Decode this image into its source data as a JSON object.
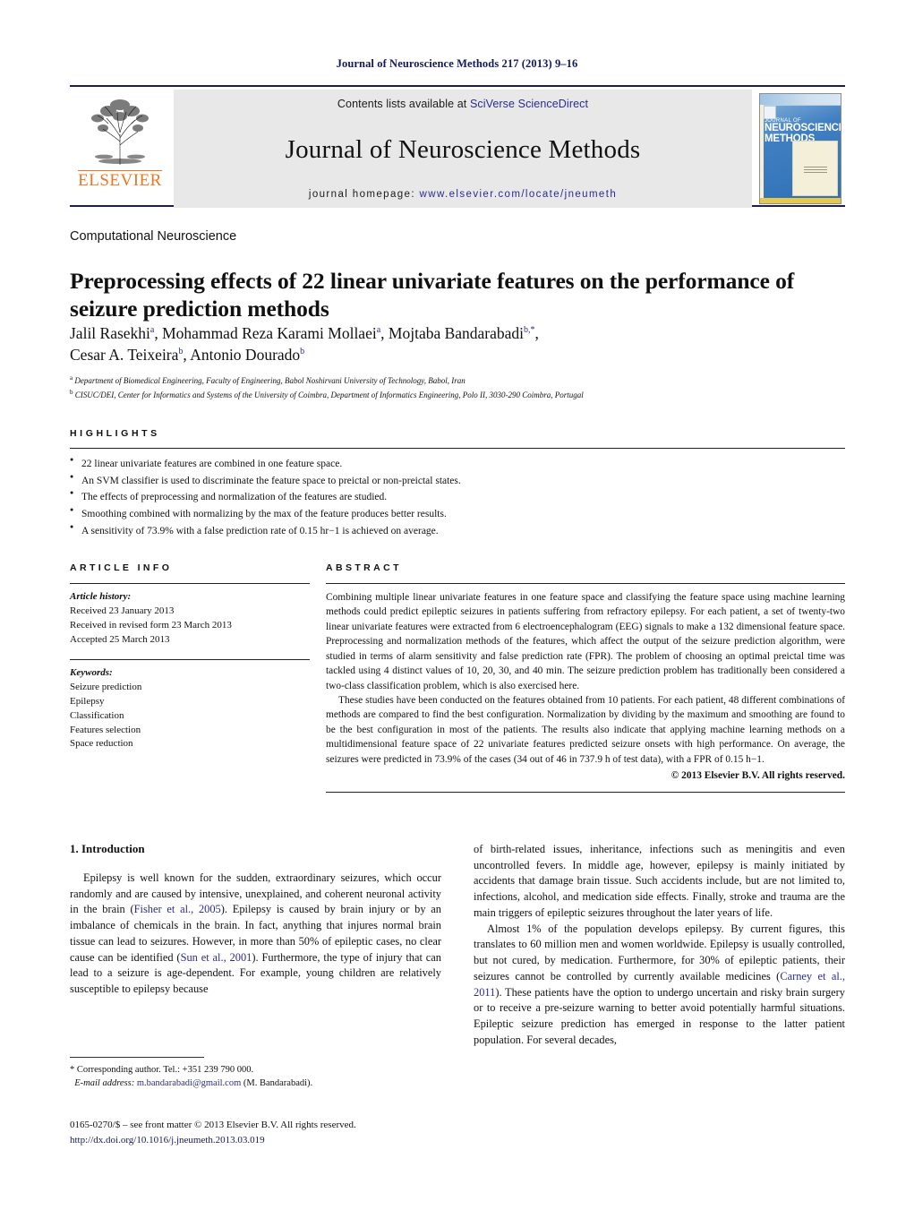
{
  "running_head": "Journal of Neuroscience Methods 217 (2013) 9–16",
  "masthead": {
    "contents_prefix": "Contents lists available at ",
    "contents_link": "SciVerse ScienceDirect",
    "journal_name": "Journal of Neuroscience Methods",
    "homepage_prefix": "journal homepage: ",
    "homepage_link": "www.elsevier.com/locate/jneumeth",
    "publisher": "ELSEVIER",
    "cover": {
      "line1": "JOURNAL OF",
      "line2": "NEUROSCIENCE",
      "line3": "METHODS"
    }
  },
  "article": {
    "kicker": "Computational Neuroscience",
    "title": "Preprocessing effects of 22 linear univariate features on the performance of seizure prediction methods",
    "authors_line1": "Jalil Rasekhi",
    "authors": "Jalil Rasekhi a, Mohammad Reza Karami Mollaei a, Mojtaba Bandarabadi b,*, Cesar A. Teixeira b, Antonio Dourado b",
    "affiliation_a": "Department of Biomedical Engineering, Faculty of Engineering, Babol Noshirvani University of Technology, Babol, Iran",
    "affiliation_b": "CISUC/DEI, Center for Informatics and Systems of the University of Coimbra, Department of Informatics Engineering, Polo II, 3030-290 Coimbra, Portugal"
  },
  "highlights": {
    "heading": "HIGHLIGHTS",
    "items": [
      "22 linear univariate features are combined in one feature space.",
      "An SVM classifier is used to discriminate the feature space to preictal or non-preictal states.",
      "The effects of preprocessing and normalization of the features are studied.",
      "Smoothing combined with normalizing by the max of the feature produces better results.",
      "A sensitivity of 73.9% with a false prediction rate of 0.15 hr−1 is achieved on average."
    ]
  },
  "article_info": {
    "heading": "ARTICLE INFO",
    "history_label": "Article history:",
    "history": [
      "Received 23 January 2013",
      "Received in revised form 23 March 2013",
      "Accepted 25 March 2013"
    ],
    "keywords_label": "Keywords:",
    "keywords": [
      "Seizure prediction",
      "Epilepsy",
      "Classification",
      "Features selection",
      "Space reduction"
    ]
  },
  "abstract": {
    "heading": "ABSTRACT",
    "paragraph1": "Combining multiple linear univariate features in one feature space and classifying the feature space using machine learning methods could predict epileptic seizures in patients suffering from refractory epilepsy. For each patient, a set of twenty-two linear univariate features were extracted from 6 electroencephalogram (EEG) signals to make a 132 dimensional feature space. Preprocessing and normalization methods of the features, which affect the output of the seizure prediction algorithm, were studied in terms of alarm sensitivity and false prediction rate (FPR). The problem of choosing an optimal preictal time was tackled using 4 distinct values of 10, 20, 30, and 40 min. The seizure prediction problem has traditionally been considered a two-class classification problem, which is also exercised here.",
    "paragraph2": "These studies have been conducted on the features obtained from 10 patients. For each patient, 48 different combinations of methods are compared to find the best configuration. Normalization by dividing by the maximum and smoothing are found to be the best configuration in most of the patients. The results also indicate that applying machine learning methods on a multidimensional feature space of 22 univariate features predicted seizure onsets with high performance. On average, the seizures were predicted in 73.9% of the cases (34 out of 46 in 737.9 h of test data), with a FPR of 0.15 h−1.",
    "copyright": "© 2013 Elsevier B.V. All rights reserved."
  },
  "introduction": {
    "number_title": "1. Introduction",
    "left_p1_a": "Epilepsy is well known for the sudden, extraordinary seizures, which occur randomly and are caused by intensive, unexplained, and coherent neuronal activity in the brain (",
    "left_cite1": "Fisher et al., 2005",
    "left_p1_b": "). Epilepsy is caused by brain injury or by an imbalance of chemicals in the brain. In fact, anything that injures normal brain tissue can lead to seizures. However, in more than 50% of epileptic cases, no clear cause can be identified (",
    "left_cite2": "Sun et al., 2001",
    "left_p1_c": "). Furthermore, the type of injury that can lead to a seizure is age-dependent. For example, young children are relatively susceptible to epilepsy because",
    "right_p1": "of birth-related issues, inheritance, infections such as meningitis and even uncontrolled fevers. In middle age, however, epilepsy is mainly initiated by accidents that damage brain tissue. Such accidents include, but are not limited to, infections, alcohol, and medication side effects. Finally, stroke and trauma are the main triggers of epileptic seizures throughout the later years of life.",
    "right_p2_a": "Almost 1% of the population develops epilepsy. By current figures, this translates to 60 million men and women worldwide. Epilepsy is usually controlled, but not cured, by medication. Furthermore, for 30% of epileptic patients, their seizures cannot be controlled by currently available medicines (",
    "right_cite1": "Carney et al., 2011",
    "right_p2_b": "). These patients have the option to undergo uncertain and risky brain surgery or to receive a pre-seizure warning to better avoid potentially harmful situations. Epileptic seizure prediction has emerged in response to the latter patient population. For several decades,"
  },
  "footer": {
    "corresponding": "* Corresponding author. Tel.: +351 239 790 000.",
    "email_label": "E-mail address:",
    "email": "m.bandarabadi@gmail.com",
    "email_suffix": "(M. Bandarabadi).",
    "issn_line": "0165-0270/$ – see front matter © 2013 Elsevier B.V. All rights reserved.",
    "doi": "http://dx.doi.org/10.1016/j.jneumeth.2013.03.019"
  },
  "colors": {
    "link_blue": "#2b2b8f",
    "header_navy": "#13195e",
    "elsevier_orange": "#e87722",
    "band_gray": "#e8e8e8"
  }
}
